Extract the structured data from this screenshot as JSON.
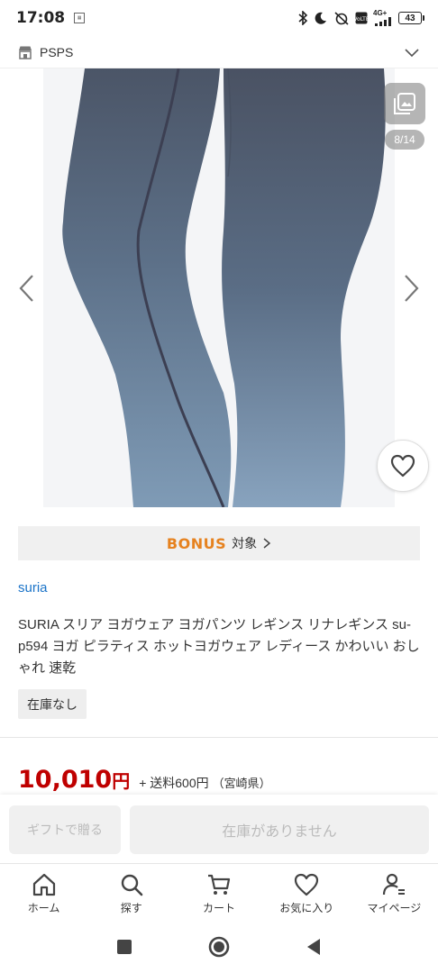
{
  "status_bar": {
    "time": "17:08",
    "network": "4G+",
    "battery": "43"
  },
  "shop_header": {
    "name": "PSPS"
  },
  "gallery": {
    "counter": "8/14"
  },
  "bonus": {
    "logo": "BONUS",
    "label": "対象"
  },
  "product": {
    "brand": "suria",
    "title": "SURIA スリア ヨガウェア ヨガパンツ レギンス リナレギンス su-p594 ヨガ ピラティス ホットヨガウェア レディース かわいい おしゃれ 速乾",
    "stock_status": "在庫なし",
    "price": "10,010",
    "price_unit": "円",
    "shipping": "+ 送料600円",
    "region": "（宮崎県）"
  },
  "actions": {
    "gift_label": "ギフトで贈る",
    "stock_label": "在庫がありません"
  },
  "tabs": [
    {
      "label": "ホーム",
      "icon": "home-icon"
    },
    {
      "label": "探す",
      "icon": "search-icon"
    },
    {
      "label": "カート",
      "icon": "cart-icon"
    },
    {
      "label": "お気に入り",
      "icon": "heart-icon"
    },
    {
      "label": "マイページ",
      "icon": "user-icon"
    }
  ],
  "colors": {
    "price": "#bf0000",
    "brand_link": "#1a73c8",
    "bonus": "#e6821f"
  }
}
